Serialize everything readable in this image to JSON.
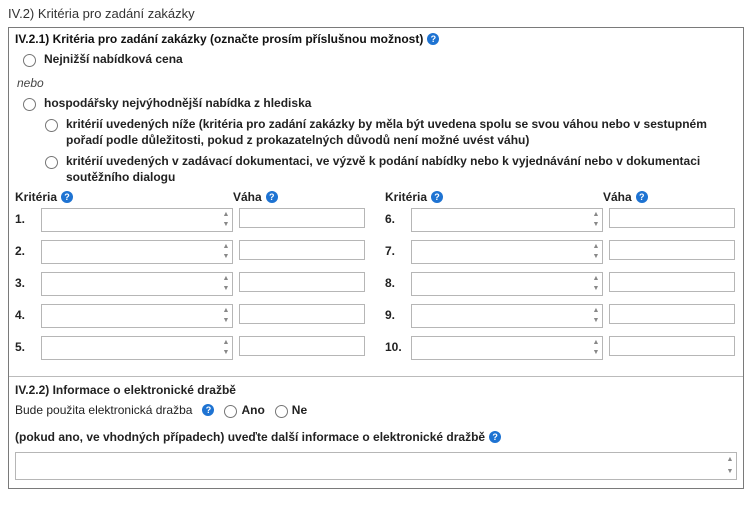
{
  "section_number": "IV.2) Kritéria pro zadání zakázky",
  "s21": {
    "title": "IV.2.1) Kritéria pro zadání zakázky (označte prosím příslušnou možnost)",
    "opt_lowest": "Nejnižší nabídková cena",
    "or": "nebo",
    "opt_econ": "hospodářsky nejvýhodnější nabídka z hlediska",
    "sub_below": "kritérií uvedených níže (kritéria pro zadání zakázky by měla být uvedena spolu se svou váhou nebo v sestupném pořadí podle důležitosti, pokud z prokazatelných důvodů není možné uvést váhu)",
    "sub_docs": "kritérií uvedených v zadávací dokumentaci, ve výzvě k podání nabídky nebo k vyjednávání nebo v dokumentaci soutěžního dialogu",
    "col_criteria": "Kritéria",
    "col_weight": "Váha",
    "rows_left": [
      "1.",
      "2.",
      "3.",
      "4.",
      "5."
    ],
    "rows_right": [
      "6.",
      "7.",
      "8.",
      "9.",
      "10."
    ]
  },
  "s22": {
    "title": "IV.2.2) Informace o elektronické dražbě",
    "question": "Bude použita elektronická dražba",
    "yes": "Ano",
    "no": "Ne",
    "prompt": "(pokud ano, ve vhodných případech) uveďte další informace o elektronické dražbě"
  }
}
